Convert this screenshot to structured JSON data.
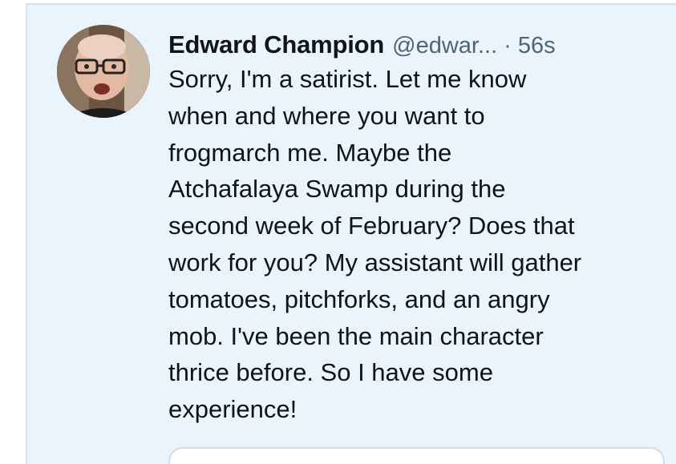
{
  "tweet": {
    "display_name": "Edward Champion",
    "handle": "@edwar...",
    "separator": "·",
    "timestamp": "56s",
    "text_lines": [
      "Sorry, I'm a satirist. Let me know",
      "when and where you want to",
      "frogmarch me. Maybe the",
      "Atchafalaya Swamp during the",
      "second week of February? Does that",
      "work for you? My assistant will gather",
      "tomatoes, pitchforks, and an angry",
      "mob. I've been the main character",
      "thrice before. So I have some",
      "experience!"
    ]
  },
  "colors": {
    "card_background": "#eaf4fd",
    "name_color": "#111418",
    "meta_color": "#536471",
    "text_color": "#0f1419"
  }
}
